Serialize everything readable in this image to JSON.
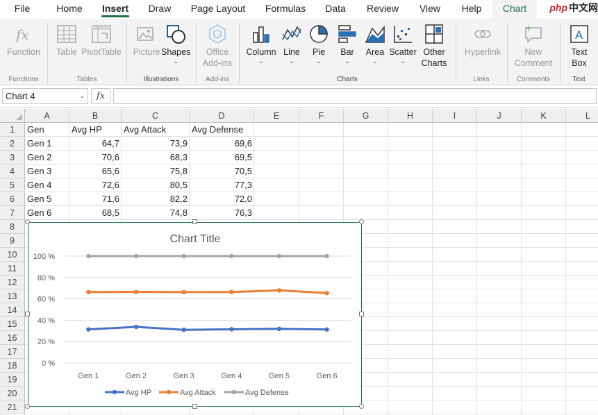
{
  "tabs": [
    {
      "label": "File",
      "active": false
    },
    {
      "label": "Home",
      "active": false
    },
    {
      "label": "Insert",
      "active": true
    },
    {
      "label": "Draw",
      "active": false
    },
    {
      "label": "Page Layout",
      "active": false
    },
    {
      "label": "Formulas",
      "active": false
    },
    {
      "label": "Data",
      "active": false
    },
    {
      "label": "Review",
      "active": false
    },
    {
      "label": "View",
      "active": false
    },
    {
      "label": "Help",
      "active": false
    },
    {
      "label": "Chart",
      "active": false
    }
  ],
  "watermark": {
    "php": "php",
    "cn": "中文网"
  },
  "ribbon": {
    "function": {
      "line1": "Function"
    },
    "table": {
      "line1": "Table"
    },
    "pivottable": {
      "line1": "PivotTable"
    },
    "picture": {
      "line1": "Picture"
    },
    "shapes": {
      "line1": "Shapes"
    },
    "office_addins": {
      "line1": "Office",
      "line2": "Add-ins"
    },
    "column": {
      "line1": "Column"
    },
    "line": {
      "line1": "Line"
    },
    "pie": {
      "line1": "Pie"
    },
    "bar": {
      "line1": "Bar"
    },
    "area": {
      "line1": "Area"
    },
    "scatter": {
      "line1": "Scatter"
    },
    "other_charts": {
      "line1": "Other",
      "line2": "Charts"
    },
    "hyperlink": {
      "line1": "Hyperlink"
    },
    "new_comment": {
      "line1": "New",
      "line2": "Comment"
    },
    "text_box": {
      "line1": "Text",
      "line2": "Box"
    },
    "groups": {
      "functions": "Functions",
      "tables": "Tables",
      "illustrations": "Illustrations",
      "addins": "Add-ins",
      "charts": "Charts",
      "links": "Links",
      "comments": "Comments",
      "text": "Text"
    }
  },
  "formula_bar": {
    "name_box": "Chart 4",
    "fx": "fx",
    "formula": ""
  },
  "columns": [
    "A",
    "B",
    "C",
    "D",
    "E",
    "F",
    "G",
    "H",
    "I",
    "J",
    "K",
    "L"
  ],
  "rows": [
    "1",
    "2",
    "3",
    "4",
    "5",
    "6",
    "7",
    "8",
    "9",
    "10",
    "11",
    "12",
    "13",
    "14",
    "15",
    "16",
    "17",
    "18",
    "19",
    "20",
    "21"
  ],
  "sheet": {
    "headers": [
      "Gen",
      "Avg HP",
      "Avg Attack",
      "Avg Defense"
    ],
    "data": [
      [
        "Gen 1",
        "64,7",
        "73,9",
        "69,6"
      ],
      [
        "Gen 2",
        "70,6",
        "68,3",
        "69,5"
      ],
      [
        "Gen 3",
        "65,6",
        "75,8",
        "70,5"
      ],
      [
        "Gen 4",
        "72,6",
        "80,5",
        "77,3"
      ],
      [
        "Gen 5",
        "71,6",
        "82,2",
        "72,0"
      ],
      [
        "Gen 6",
        "68,5",
        "74,8",
        "76,3"
      ]
    ]
  },
  "chart_data": {
    "type": "line",
    "title": "Chart Title",
    "categories": [
      "Gen 1",
      "Gen 2",
      "Gen 3",
      "Gen 4",
      "Gen 5",
      "Gen 6"
    ],
    "y_ticks": [
      "0 %",
      "20 %",
      "40 %",
      "60 %",
      "80 %",
      "100 %"
    ],
    "ylim": [
      0,
      100
    ],
    "grid": true,
    "legend_position": "bottom",
    "series": [
      {
        "name": "Avg HP",
        "color": "#4472c4",
        "values": [
          31.4,
          33.8,
          31.0,
          31.5,
          31.9,
          31.3
        ]
      },
      {
        "name": "Avg Attack",
        "color": "#ed7d31",
        "values": [
          66.3,
          66.5,
          66.3,
          66.4,
          67.9,
          65.4
        ]
      },
      {
        "name": "Avg Defense",
        "color": "#a5a5a5",
        "values": [
          100,
          100,
          100,
          100,
          100,
          100
        ]
      }
    ]
  }
}
